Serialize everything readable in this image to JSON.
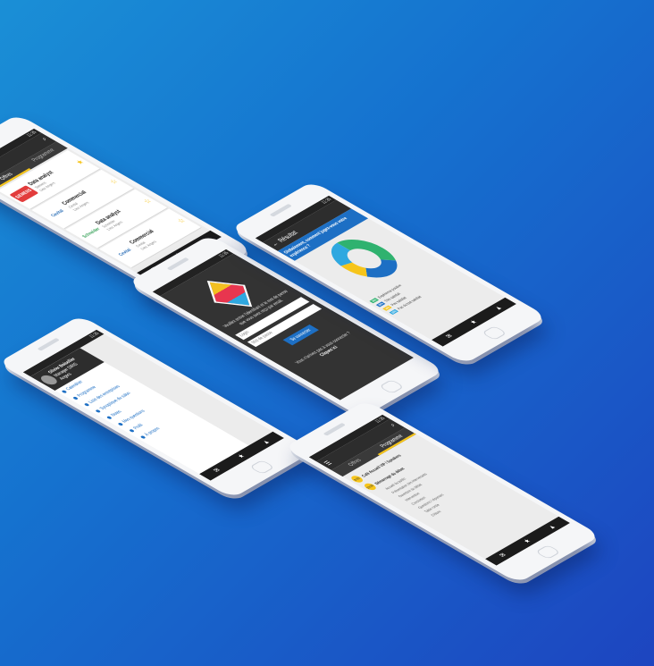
{
  "offers": {
    "status_time": "11:35",
    "tabs": [
      "Offres",
      "Programme"
    ],
    "items": [
      {
        "logo": "SIEMENS",
        "logo_color": "#e23c3c",
        "title": "Data analyst",
        "company": "Siemens",
        "place": "Lieu: Angers",
        "date": "16 Juin 2017"
      },
      {
        "logo": "Cevital",
        "logo_color": "#f6c51b",
        "title": "Commercial",
        "company": "Cevital",
        "place": "Lieu: Angers",
        "date": "16 Juin 2017"
      },
      {
        "logo": "Schneider",
        "logo_color": "#3aa35b",
        "title": "Data analyst",
        "company": "Schneider",
        "place": "Lieu: Angers",
        "date": "16 Juin 2017"
      },
      {
        "logo": "Cevital",
        "logo_color": "#f6c51b",
        "title": "Commercial",
        "company": "Cevital",
        "place": "Lieu: Angers",
        "date": "16 Juin 2017"
      }
    ]
  },
  "login": {
    "status_time": "11:35",
    "intro": "Veuillez entrer l'identifiant et le mot de passe que vous avez reçu par email.",
    "id_placeholder": "Login",
    "pwd_placeholder": "Mot de passe",
    "connect_label": "Se connecter",
    "forgot": "Vous n'arrivez pas à vous connecter ?",
    "help_link": "Cliquez ici"
  },
  "result": {
    "status_time": "11:35",
    "title": "Résultat",
    "question": "Globalement, comment jugez-vous votre expérience ?",
    "legend": [
      {
        "pct": "36%",
        "color": "#2fb26f",
        "label": "Expérience positive"
      },
      {
        "pct": "28%",
        "color": "#1d6fc4",
        "label": "Très satisfait"
      },
      {
        "pct": "14%",
        "color": "#f6c51b",
        "label": "Peu satisfait"
      },
      {
        "pct": "22%",
        "color": "#2fa8e0",
        "label": "Pas du tout satisfait"
      }
    ]
  },
  "menu": {
    "status_time": "11:35",
    "user_name": "Olivier Boisellier",
    "user_role": "Manager SIRIS",
    "user_place": "Angers",
    "items": [
      "Calendrier",
      "Programme",
      "Liste des entreprises",
      "Synoptique du salon",
      "Notes",
      "Mes questions",
      "Profil",
      "À propos"
    ]
  },
  "program": {
    "status_time": "11:35",
    "tabs": [
      "Offres",
      "Programme"
    ],
    "events": [
      {
        "time": "9:30",
        "title": "Café Accueil VIP / Speakers"
      },
      {
        "time": "10:00",
        "title": "Démarrage du débat"
      }
    ],
    "subitems": [
      "Accueil du public",
      "Présentation des intervenants",
      "Ouverture du débat",
      "Intervention",
      "Conclusion",
      "Questions / réponses",
      "Table ronde",
      "Clôture"
    ]
  }
}
